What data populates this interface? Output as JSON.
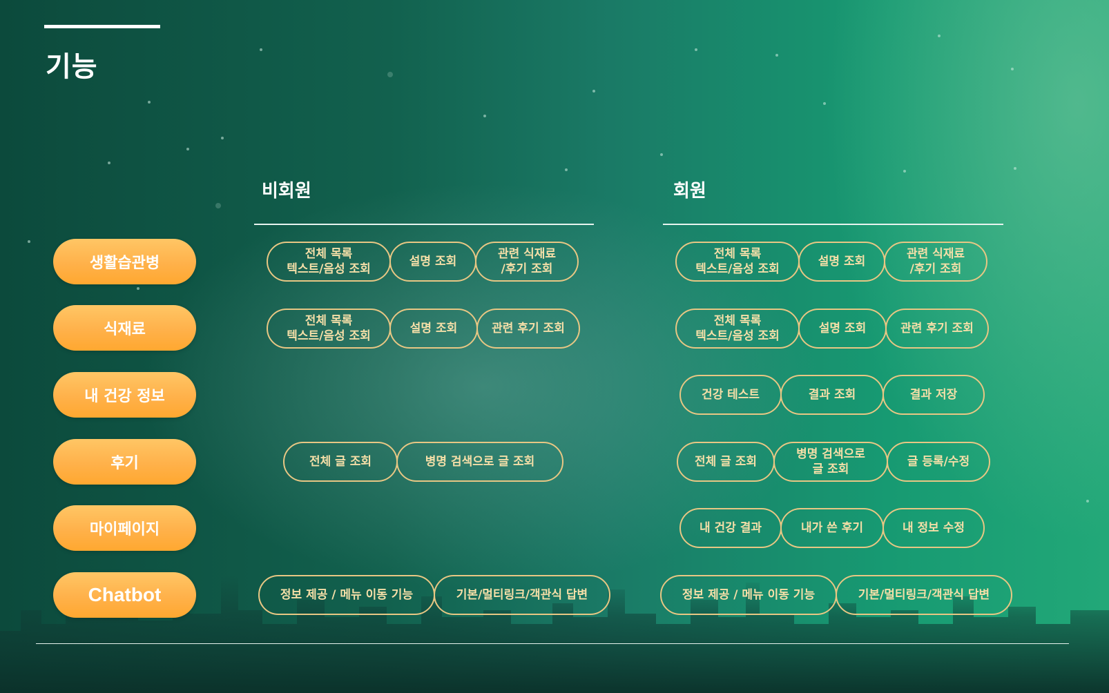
{
  "page": {
    "title": "기능"
  },
  "columns": {
    "guest": "비회원",
    "member": "회원"
  },
  "rows": [
    {
      "label": "생활습관병",
      "guest": [
        "전체 목록\n텍스트/음성 조회",
        "설명 조회",
        "관련 식재료\n/후기 조회"
      ],
      "member": [
        "전체 목록\n텍스트/음성 조회",
        "설명 조회",
        "관련 식재료\n/후기 조회"
      ]
    },
    {
      "label": "식재료",
      "guest": [
        "전체 목록\n텍스트/음성 조회",
        "설명 조회",
        "관련 후기 조회"
      ],
      "member": [
        "전체 목록\n텍스트/음성 조회",
        "설명 조회",
        "관련 후기 조회"
      ]
    },
    {
      "label": "내 건강 정보",
      "guest": [],
      "member": [
        "건강 테스트",
        "결과 조회",
        "결과 저장"
      ]
    },
    {
      "label": "후기",
      "guest": [
        "전체 글 조회",
        "병명 검색으로 글 조회"
      ],
      "member": [
        "전체 글 조회",
        "병명 검색으로\n글 조회",
        "글 등록/수정"
      ]
    },
    {
      "label": "마이페이지",
      "guest": [],
      "member": [
        "내 건강 결과",
        "내가 쓴 후기",
        "내 정보 수정"
      ]
    },
    {
      "label": "Chatbot",
      "guest": [
        "정보 제공 / 메뉴 이동 기능",
        "기본/멀티링크/객관식 답변"
      ],
      "member": [
        "정보 제공 / 메뉴 이동 기능",
        "기본/멀티링크/객관식 답변"
      ]
    }
  ],
  "colors": {
    "pill_border": "#e8c784",
    "pill_text": "#f5dfa8",
    "label_fill": "#ffb14a"
  }
}
